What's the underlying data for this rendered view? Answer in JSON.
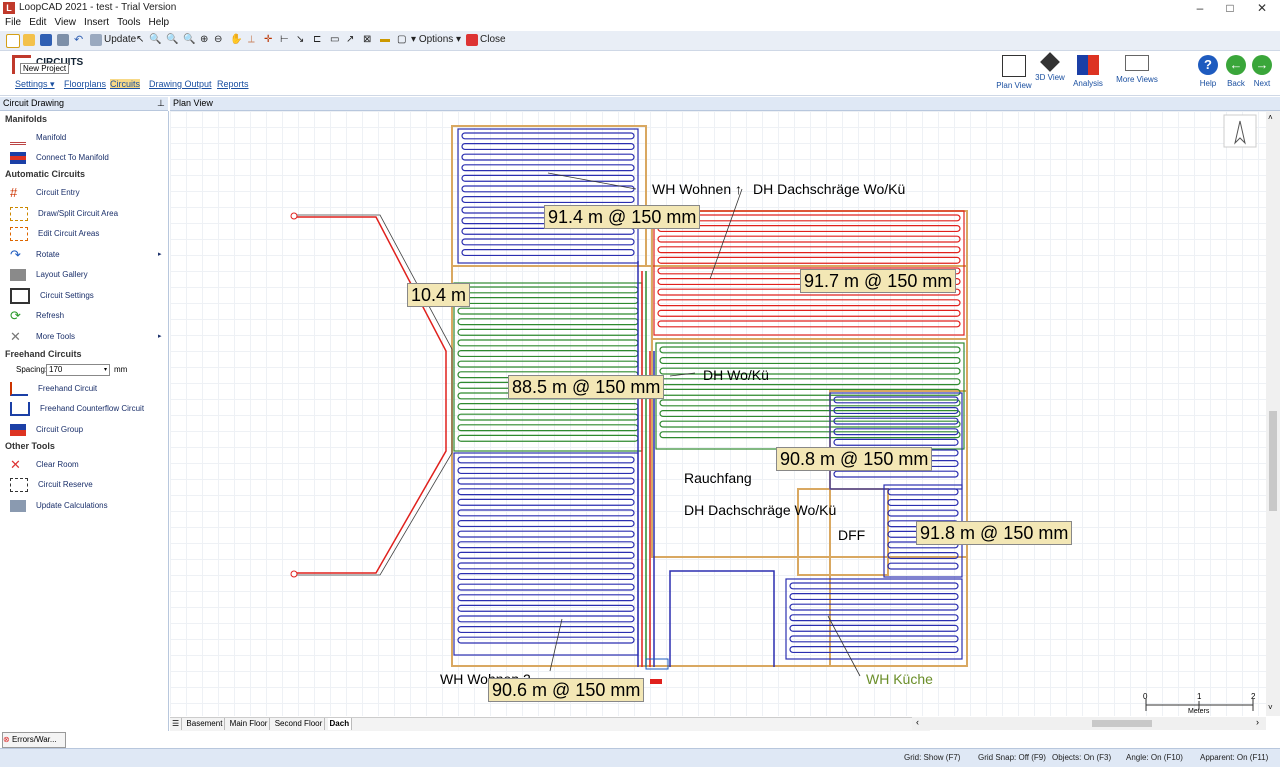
{
  "window": {
    "title": "LoopCAD 2021 - test - Trial Version",
    "logo": "L"
  },
  "menu": [
    "File",
    "Edit",
    "View",
    "Insert",
    "Tools",
    "Help"
  ],
  "toolbar": {
    "update": "Update",
    "options": "Options",
    "close": "Close",
    "tooltip": "New Project"
  },
  "ribbon": {
    "title": "CIRCUITS",
    "nav": [
      "Settings",
      "Floorplans",
      "Circuits",
      "Drawing Output",
      "Reports"
    ],
    "buttons": [
      "Plan View",
      "3D View",
      "Analysis",
      "More Views",
      "Help",
      "Back",
      "Next"
    ]
  },
  "left_panel": {
    "header": "Circuit Drawing",
    "sections": {
      "manifolds": "Manifolds",
      "automatic": "Automatic Circuits",
      "freehand": "Freehand Circuits",
      "other": "Other Tools"
    },
    "items": {
      "manifold": "Manifold",
      "connect": "Connect To Manifold",
      "entry": "Circuit Entry",
      "draw_split": "Draw/Split Circuit Area",
      "edit_areas": "Edit Circuit Areas",
      "rotate": "Rotate",
      "layout_gallery": "Layout Gallery",
      "circuit_settings": "Circuit Settings",
      "refresh": "Refresh",
      "more_tools": "More Tools",
      "freehand_circuit": "Freehand Circuit",
      "counterflow": "Freehand Counterflow Circuit",
      "group": "Circuit Group",
      "clear_room": "Clear Room",
      "reserve": "Circuit Reserve",
      "update_calc": "Update Calculations"
    },
    "spacing": {
      "label": "Spacing:",
      "value": "170",
      "unit": "mm"
    }
  },
  "plan_view": {
    "header": "Plan View",
    "labels": {
      "l1": "91.4 m @ 150 mm",
      "l2": "91.7 m @ 150 mm",
      "l3": "10.4 m",
      "l4": "88.5 m @ 150 mm",
      "l5": "90.8 m @ 150 mm",
      "l6": "91.8 m @ 150 mm",
      "l7": "90.6 m @ 150 mm"
    },
    "rooms": {
      "r1": "WH Wohnen",
      "r2": "DH Dachschräge Wo/Kü",
      "r3": "DH Wo/Kü",
      "r4": "Rauchfang",
      "r5": "DH Dachschräge Wo/Kü",
      "r6": "DFF",
      "r7": "WH Küche",
      "r8": "WH Wohnen 2"
    },
    "scale": {
      "t0": "0",
      "t1": "1",
      "t2": "2",
      "unit": "Meters"
    }
  },
  "floor_tabs": [
    "Basement",
    "Main Floor",
    "Second Floor",
    "Dach"
  ],
  "errors": "Errors/War...",
  "status": {
    "grid": "Grid: Show (F7)",
    "snap": "Grid Snap: Off (F9)",
    "objects": "Objects: On (F3)",
    "angle": "Angle: On (F10)",
    "apparent": "Apparent: On (F11)"
  },
  "colors": {
    "blue": "#2b2fb0",
    "red": "#e0211d",
    "green": "#2f8a2f",
    "room_border": "#d9a861",
    "accent": "#1a4fa0"
  }
}
